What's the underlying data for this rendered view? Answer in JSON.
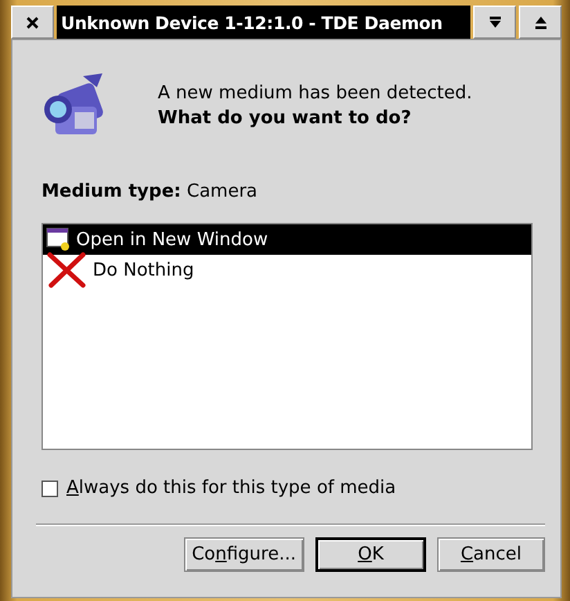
{
  "window": {
    "title": "Unknown Device 1-12:1.0 - TDE Daemon"
  },
  "message": {
    "line": "A new medium has been detected.",
    "question": "What do you want to do?"
  },
  "medium_type": {
    "label": "Medium type:",
    "value": "Camera"
  },
  "actions": [
    {
      "kind": "open",
      "label": "Open in New Window",
      "selected": true
    },
    {
      "kind": "nothing",
      "label": "Do Nothing",
      "selected": false
    }
  ],
  "always": {
    "label": {
      "key": "A",
      "rest": "lways do this for this type of media"
    },
    "checked": false
  },
  "buttons": [
    {
      "label": {
        "lead": "Co",
        "key": "n",
        "rest": "figure..."
      },
      "default": false
    },
    {
      "label": {
        "key": "O",
        "rest": "K"
      },
      "default": true
    },
    {
      "label": {
        "key": "C",
        "rest": "ancel"
      },
      "default": false
    }
  ]
}
